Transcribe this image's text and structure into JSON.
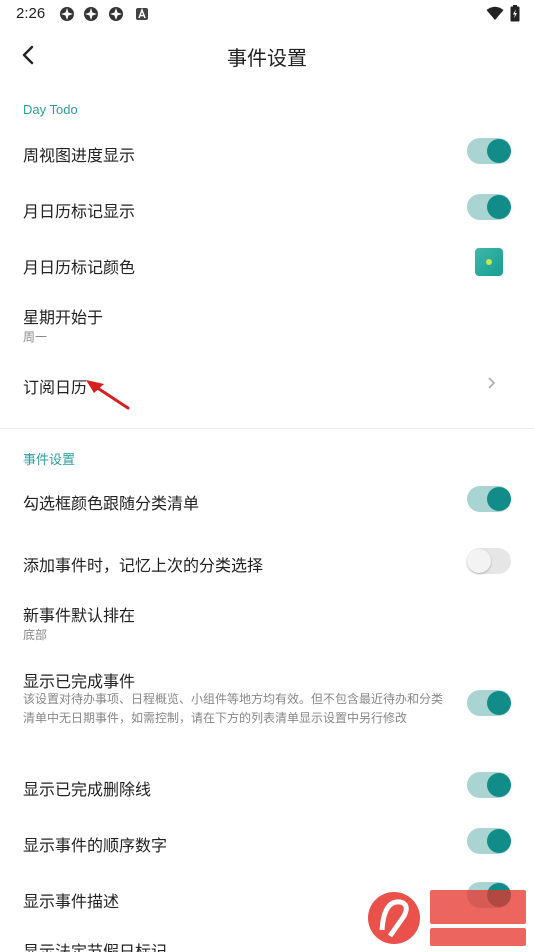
{
  "status_bar": {
    "time": "2:26",
    "battery_icon": "battery-charging-icon",
    "wifi_icon": "wifi-icon"
  },
  "app_bar": {
    "title": "事件设置",
    "back_icon": "back-arrow-icon"
  },
  "section1": {
    "title": "Day Todo",
    "items": [
      {
        "label": "周视图进度显示",
        "control": "toggle",
        "on": true
      },
      {
        "label": "月日历标记显示",
        "control": "toggle",
        "on": true
      },
      {
        "label": "月日历标记颜色",
        "control": "color",
        "color": "#1f9e92"
      },
      {
        "label": "星期开始于",
        "value": "周一"
      },
      {
        "label": "订阅日历",
        "control": "chevron"
      }
    ]
  },
  "section2": {
    "title": "事件设置",
    "items": [
      {
        "label": "勾选框颜色跟随分类清单",
        "control": "toggle",
        "on": true
      },
      {
        "label": "添加事件时，记忆上次的分类选择",
        "control": "toggle",
        "on": false
      },
      {
        "label": "新事件默认排在",
        "value": "底部"
      },
      {
        "label": "显示已完成事件",
        "desc": "该设置对待办事项、日程概览、小组件等地方均有效。但不包含最近待办和分类清单中无日期事件，如需控制，请在下方的列表清单显示设置中另行修改",
        "control": "toggle",
        "on": true
      },
      {
        "label": "显示已完成删除线",
        "control": "toggle",
        "on": true
      },
      {
        "label": "显示事件的顺序数字",
        "control": "toggle",
        "on": true
      },
      {
        "label": "显示事件描述",
        "control": "toggle",
        "on": true
      },
      {
        "label": "显示法定节假日标记"
      }
    ]
  },
  "colors": {
    "accent": "#128c89",
    "track_on": "#a9d4d2",
    "section_title": "#2a9d9f"
  }
}
